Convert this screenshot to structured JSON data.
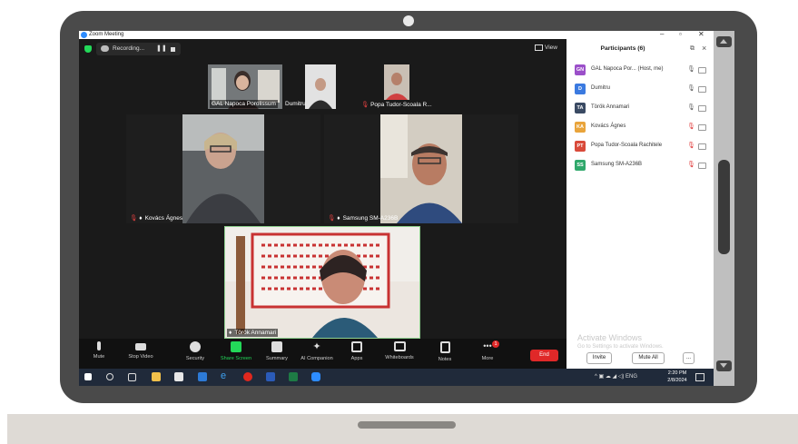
{
  "window": {
    "title": "Zoom Meeting"
  },
  "meeting_bar": {
    "recording_label": "Recording...",
    "view_label": "View"
  },
  "gallery": {
    "top_tiles": [
      {
        "name": "GAL Napoca Porolissum"
      },
      {
        "name": "Dumitru"
      },
      {
        "name": "Popa Tudor-Scoala R..."
      }
    ],
    "mid_tiles": [
      {
        "name": "Kovács Ágnes"
      },
      {
        "name": "Samsung SM-A236B"
      }
    ],
    "active_tile": {
      "name": "Török Annamari"
    }
  },
  "toolbar": {
    "mute": "Mute",
    "stop_video": "Stop Video",
    "security": "Security",
    "share_screen": "Share Screen",
    "summary": "Summary",
    "ai_companion": "AI Companion",
    "apps": "Apps",
    "whiteboards": "Whiteboards",
    "notes": "Notes",
    "more": "More",
    "more_badge": "1",
    "end": "End",
    "share_color": "#23d959",
    "end_color": "#e02828"
  },
  "participants": {
    "title": "Participants (6)",
    "list": [
      {
        "initials": "GN",
        "name": "GAL Napoca Por...",
        "tag": "(Host, me)",
        "color": "#9b4fc9",
        "muted": false
      },
      {
        "initials": "D",
        "name": "Dumitru",
        "tag": "",
        "color": "#3b7ae0",
        "muted": false
      },
      {
        "initials": "TA",
        "name": "Török Annamari",
        "tag": "",
        "color": "#3a4a63",
        "muted": false
      },
      {
        "initials": "KA",
        "name": "Kovács Ágnes",
        "tag": "",
        "color": "#e9a43b",
        "muted": true
      },
      {
        "initials": "PT",
        "name": "Popa Tudor-Scoala Rachitele",
        "tag": "",
        "color": "#d94a3a",
        "muted": true
      },
      {
        "initials": "SS",
        "name": "Samsung SM-A236B",
        "tag": "",
        "color": "#2fa86b",
        "muted": true
      }
    ],
    "invite": "Invite",
    "mute_all": "Mute All",
    "more": "...",
    "watermark_title": "Activate Windows",
    "watermark_sub": "Go to Settings to activate Windows."
  },
  "taskbar": {
    "lang": "ENG",
    "time": "2:20 PM",
    "date": "2/8/2024"
  }
}
